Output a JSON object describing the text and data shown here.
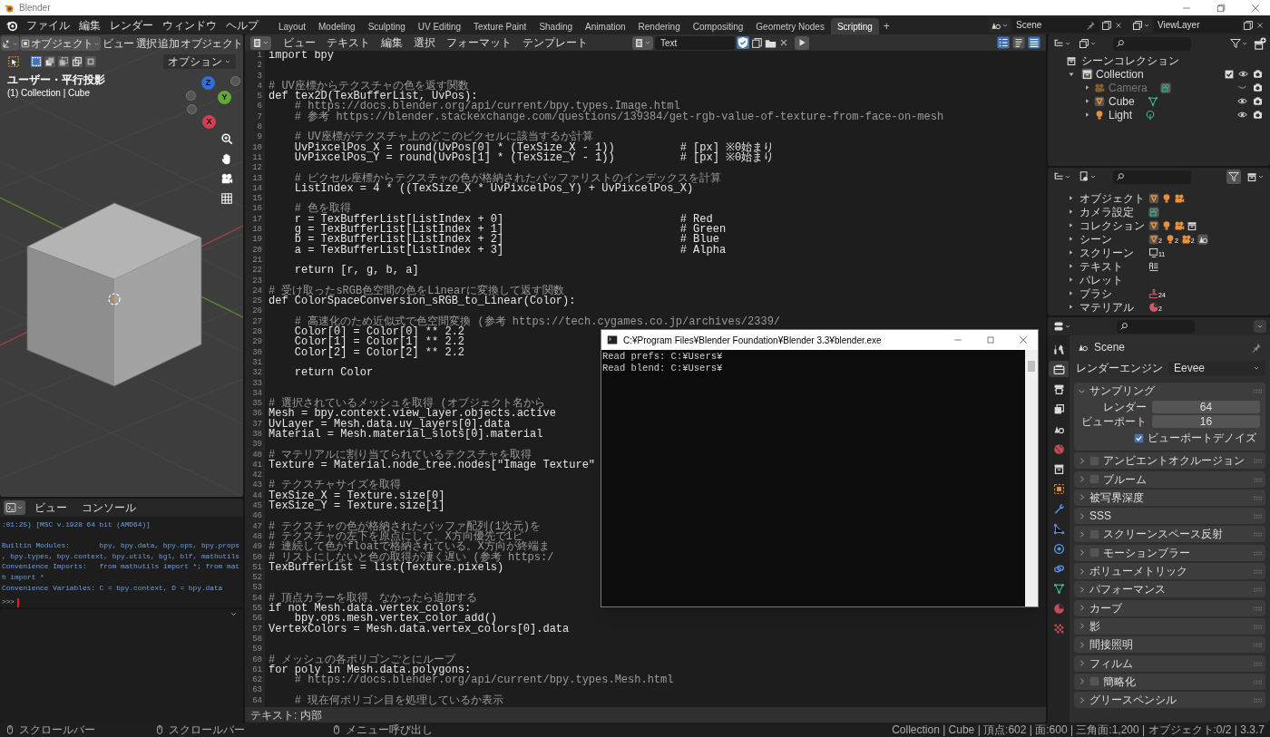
{
  "window": {
    "title": "Blender"
  },
  "menu_bar": {
    "menus": [
      "ファイル",
      "編集",
      "レンダー",
      "ウィンドウ",
      "ヘルプ"
    ],
    "workspaces": [
      {
        "label": "Layout",
        "selected": false
      },
      {
        "label": "Modeling",
        "selected": false
      },
      {
        "label": "Sculpting",
        "selected": false
      },
      {
        "label": "UV Editing",
        "selected": false
      },
      {
        "label": "Texture Paint",
        "selected": false
      },
      {
        "label": "Shading",
        "selected": false
      },
      {
        "label": "Animation",
        "selected": false
      },
      {
        "label": "Rendering",
        "selected": false
      },
      {
        "label": "Compositing",
        "selected": false
      },
      {
        "label": "Geometry Nodes",
        "selected": false
      },
      {
        "label": "Scripting",
        "selected": true
      }
    ],
    "add_workspace": "+",
    "scene": "Scene",
    "view_layer": "ViewLayer"
  },
  "viewport": {
    "mode": "オブジェクト",
    "menus": [
      "ビュー",
      "選択",
      "追加",
      "オブジェクト"
    ],
    "options": "オプション",
    "view_name": "ユーザー・平行投影",
    "context": "(1) Collection | Cube",
    "gizmo_axes": [
      {
        "label": "Z",
        "color": "#2f6fd6"
      },
      {
        "label": "Y",
        "color": "#62a83a"
      },
      {
        "label": "X",
        "color": "#d33f52"
      }
    ]
  },
  "console": {
    "menus": [
      "ビュー",
      "コンソール"
    ],
    "lines": [
      {
        "kind": "output",
        "text": ":01:25) [MSC v.1928 64 bit (AMD64)]"
      },
      {
        "kind": "blank"
      },
      {
        "kind": "output",
        "text": "Builtin Modules:       bpy, bpy.data, bpy.ops, bpy.props"
      },
      {
        "kind": "output",
        "text": ", bpy.types, bpy.context, bpy.utils, bgl, blf, mathutils"
      },
      {
        "kind": "output",
        "text": "Convenience Imports:   from mathutils import *; from mat"
      },
      {
        "kind": "output",
        "text": "h import *"
      },
      {
        "kind": "output",
        "text": "Convenience Variables: C = bpy.context, D = bpy.data"
      }
    ],
    "prompt": ">>>"
  },
  "text_editor": {
    "menus": [
      "ビュー",
      "テキスト",
      "編集",
      "選択",
      "フォーマット",
      "テンプレート"
    ],
    "text_name": "Text",
    "fake_user": true,
    "toggles": [
      {
        "kind": "line-numbers",
        "on": true
      },
      {
        "kind": "word-wrap",
        "on": false
      },
      {
        "kind": "syntax",
        "on": true
      }
    ],
    "lines": [
      {
        "number": "1",
        "kind": "code",
        "code": "import bpy"
      },
      {
        "number": "2",
        "kind": "blank"
      },
      {
        "number": "3",
        "kind": "blank"
      },
      {
        "number": "4",
        "kind": "comment",
        "code": "# UV座標からテクスチャの色を返す関数"
      },
      {
        "number": "5",
        "kind": "code",
        "code": "def tex2D(TexBufferList, UvPos):"
      },
      {
        "number": "6",
        "kind": "comment",
        "code": "    # https://docs.blender.org/api/current/bpy.types.Image.html"
      },
      {
        "number": "7",
        "kind": "comment",
        "code": "    # 参考 https://blender.stackexchange.com/questions/139384/get-rgb-value-of-texture-from-face-on-mesh"
      },
      {
        "number": "8",
        "kind": "blank"
      },
      {
        "number": "9",
        "kind": "comment",
        "code": "    # UV座標がテクスチャ上のどこのピクセルに該当するか計算"
      },
      {
        "number": "10",
        "kind": "code",
        "code": "    UvPixcelPos_X = round(UvPos[0] * (TexSize_X - 1))          # [px] ※0始まり"
      },
      {
        "number": "11",
        "kind": "code",
        "code": "    UvPixcelPos_Y = round(UvPos[1] * (TexSize_Y - 1))          # [px] ※0始まり"
      },
      {
        "number": "12",
        "kind": "blank"
      },
      {
        "number": "13",
        "kind": "comment",
        "code": "    # ピクセル座標からテクスチャの色が格納されたバッファリストのインデックスを計算"
      },
      {
        "number": "14",
        "kind": "code",
        "code": "    ListIndex = 4 * ((TexSize_X * UvPixcelPos_Y) + UvPixcelPos_X)"
      },
      {
        "number": "15",
        "kind": "blank"
      },
      {
        "number": "16",
        "kind": "comment",
        "code": "    # 色を取得"
      },
      {
        "number": "17",
        "kind": "code",
        "code": "    r = TexBufferList[ListIndex + 0]                           # Red"
      },
      {
        "number": "18",
        "kind": "code",
        "code": "    g = TexBufferList[ListIndex + 1]                           # Green"
      },
      {
        "number": "19",
        "kind": "code",
        "code": "    b = TexBufferList[ListIndex + 2]                           # Blue"
      },
      {
        "number": "20",
        "kind": "code",
        "code": "    a = TexBufferList[ListIndex + 3]                           # Alpha"
      },
      {
        "number": "21",
        "kind": "blank"
      },
      {
        "number": "22",
        "kind": "code",
        "code": "    return [r, g, b, a]"
      },
      {
        "number": "23",
        "kind": "blank"
      },
      {
        "number": "24",
        "kind": "comment",
        "code": "# 受け取ったsRGB色空間の色をLinearに変換して返す関数"
      },
      {
        "number": "25",
        "kind": "code",
        "code": "def ColorSpaceConversion_sRGB_to_Linear(Color):"
      },
      {
        "number": "26",
        "kind": "blank"
      },
      {
        "number": "27",
        "kind": "comment",
        "code": "    # 高速化のため近似式で色空間変換 (参考 https://tech.cygames.co.jp/archives/2339/"
      },
      {
        "number": "28",
        "kind": "code",
        "code": "    Color[0] = Color[0] ** 2.2"
      },
      {
        "number": "29",
        "kind": "code",
        "code": "    Color[1] = Color[1] ** 2.2"
      },
      {
        "number": "30",
        "kind": "code",
        "code": "    Color[2] = Color[2] ** 2.2"
      },
      {
        "number": "31",
        "kind": "blank"
      },
      {
        "number": "32",
        "kind": "code",
        "code": "    return Color"
      },
      {
        "number": "33",
        "kind": "blank"
      },
      {
        "number": "34",
        "kind": "blank"
      },
      {
        "number": "35",
        "kind": "comment",
        "code": "# 選択されているメッシュを取得 (オブジェクト名から"
      },
      {
        "number": "36",
        "kind": "code",
        "code": "Mesh = bpy.context.view_layer.objects.active"
      },
      {
        "number": "37",
        "kind": "code",
        "code": "UvLayer = Mesh.data.uv_layers[0].data"
      },
      {
        "number": "38",
        "kind": "code",
        "code": "Material = Mesh.material_slots[0].material"
      },
      {
        "number": "39",
        "kind": "blank"
      },
      {
        "number": "40",
        "kind": "comment",
        "code": "# マテリアルに割り当てられているテクスチャを取得"
      },
      {
        "number": "41",
        "kind": "code",
        "code": "Texture = Material.node_tree.nodes[\"Image Texture\""
      },
      {
        "number": "42",
        "kind": "blank"
      },
      {
        "number": "43",
        "kind": "comment",
        "code": "# テクスチャサイズを取得"
      },
      {
        "number": "44",
        "kind": "code",
        "code": "TexSize_X = Texture.size[0]"
      },
      {
        "number": "45",
        "kind": "code",
        "code": "TexSize_Y = Texture.size[1]"
      },
      {
        "number": "46",
        "kind": "blank"
      },
      {
        "number": "47",
        "kind": "comment",
        "code": "# テクスチャの色が格納されたバッファ配列(1次元)を"
      },
      {
        "number": "48",
        "kind": "comment",
        "code": "# テクスチャの左下を原点にして、X方向優先で1ピ"
      },
      {
        "number": "49",
        "kind": "comment",
        "code": "# 連続して色がfloatで格納されている。X方向が終端ま"
      },
      {
        "number": "50",
        "kind": "comment",
        "code": "# リストにしないと色の取得が凄く遅い (参考 https:/"
      },
      {
        "number": "51",
        "kind": "code",
        "code": "TexBufferList = list(Texture.pixels)"
      },
      {
        "number": "52",
        "kind": "blank"
      },
      {
        "number": "53",
        "kind": "blank"
      },
      {
        "number": "54",
        "kind": "comment",
        "code": "# 頂点カラーを取得、なかったら追加する"
      },
      {
        "number": "55",
        "kind": "code",
        "code": "if not Mesh.data.vertex_colors:"
      },
      {
        "number": "56",
        "kind": "code",
        "code": "    bpy.ops.mesh.vertex_color_add()"
      },
      {
        "number": "57",
        "kind": "code",
        "code": "VertexColors = Mesh.data.vertex_colors[0].data"
      },
      {
        "number": "58",
        "kind": "blank"
      },
      {
        "number": "59",
        "kind": "blank"
      },
      {
        "number": "60",
        "kind": "comment",
        "code": "# メッシュの各ポリゴンごとにループ"
      },
      {
        "number": "61",
        "kind": "code",
        "code": "for poly in Mesh.data.polygons:"
      },
      {
        "number": "62",
        "kind": "comment",
        "code": "    # https://docs.blender.org/api/current/bpy.types.Mesh.html"
      },
      {
        "number": "63",
        "kind": "blank"
      },
      {
        "number": "64",
        "kind": "comment",
        "code": "    # 現在何ポリゴン目を処理しているか表示"
      }
    ],
    "footer": "テキスト: 内部"
  },
  "console_window": {
    "title": "C:¥Program Files¥Blender Foundation¥Blender 3.3¥blender.exe",
    "lines": [
      "Read prefs: C:¥Users¥",
      "Read blend: C:¥Users¥"
    ]
  },
  "outliner": {
    "root": "シーンコレクション",
    "collection": {
      "label": "Collection",
      "expanded": true,
      "checked": true,
      "children": [
        {
          "label": "Camera",
          "kind": "camera",
          "visible": false
        },
        {
          "label": "Cube",
          "kind": "mesh",
          "visible": true
        },
        {
          "label": "Light",
          "kind": "light",
          "visible": true
        }
      ]
    }
  },
  "data_outliner": {
    "items": [
      {
        "label": "オブジェクト",
        "icons": [
          {
            "kind": "mesh"
          },
          {
            "kind": "light"
          },
          {
            "kind": "camera"
          }
        ]
      },
      {
        "label": "カメラ設定",
        "icons": [
          {
            "kind": "camera-data"
          }
        ]
      },
      {
        "label": "コレクション",
        "icons": [
          {
            "kind": "mesh"
          },
          {
            "kind": "light"
          },
          {
            "kind": "camera"
          },
          {
            "kind": "collection"
          }
        ]
      },
      {
        "label": "シーン",
        "icons": [
          {
            "kind": "mesh",
            "count": "2"
          },
          {
            "kind": "light",
            "count": "2"
          },
          {
            "kind": "camera",
            "count": "2"
          },
          {
            "kind": "scene"
          }
        ]
      },
      {
        "label": "スクリーン",
        "icons": [
          {
            "kind": "screen",
            "count": "11"
          }
        ]
      },
      {
        "label": "テキスト",
        "icons": [
          {
            "kind": "text"
          }
        ]
      },
      {
        "label": "パレット"
      },
      {
        "label": "ブラシ",
        "icons": [
          {
            "kind": "brush",
            "count": "24"
          }
        ]
      },
      {
        "label": "マテリアル",
        "icons": [
          {
            "kind": "material",
            "count": "2"
          }
        ]
      }
    ]
  },
  "properties": {
    "tabs": [
      {
        "kind": "tool",
        "selected": false
      },
      {
        "kind": "render",
        "selected": true
      },
      {
        "kind": "output",
        "selected": false
      },
      {
        "kind": "view-layer",
        "selected": false
      },
      {
        "kind": "scene",
        "selected": false
      },
      {
        "kind": "world",
        "selected": false
      },
      {
        "kind": "collection",
        "selected": false
      },
      {
        "kind": "object",
        "selected": false
      },
      {
        "kind": "modifier",
        "selected": false
      },
      {
        "kind": "particles",
        "selected": false
      },
      {
        "kind": "physics",
        "selected": false
      },
      {
        "kind": "constraints",
        "selected": false
      },
      {
        "kind": "data",
        "selected": false
      },
      {
        "kind": "material",
        "selected": false
      },
      {
        "kind": "texture",
        "selected": false
      }
    ],
    "context": "Scene",
    "render_engine": {
      "label": "レンダーエンジン",
      "value": "Eevee"
    },
    "sampling": {
      "title": "サンプリング",
      "expanded": true,
      "fields": [
        {
          "label": "レンダー",
          "value": "64"
        },
        {
          "label": "ビューポート",
          "value": "16"
        }
      ],
      "option": {
        "label": "ビューポートデノイズ",
        "checked": true
      }
    },
    "panels": [
      {
        "title": "アンビエントオクルージョン",
        "kind": "toggle",
        "checked": false
      },
      {
        "title": "ブルーム",
        "kind": "toggle",
        "checked": false
      },
      {
        "title": "被写界深度",
        "kind": "plain"
      },
      {
        "title": "SSS",
        "kind": "plain"
      },
      {
        "title": "スクリーンスペース反射",
        "kind": "toggle",
        "checked": false
      },
      {
        "title": "モーションブラー",
        "kind": "toggle",
        "checked": false
      },
      {
        "title": "ボリューメトリック",
        "kind": "plain"
      },
      {
        "title": "パフォーマンス",
        "kind": "plain"
      },
      {
        "title": "カーブ",
        "kind": "plain"
      },
      {
        "title": "影",
        "kind": "plain"
      },
      {
        "title": "間接照明",
        "kind": "plain"
      },
      {
        "title": "フィルム",
        "kind": "plain"
      },
      {
        "title": "簡略化",
        "kind": "toggle",
        "checked": false
      },
      {
        "title": "グリースペンシル",
        "kind": "plain"
      }
    ]
  },
  "status_bar": {
    "hints": [
      "スクロールバー",
      "スクロールバー",
      "メニュー呼び出し"
    ],
    "stats": "Collection | Cube | 頂点:602 | 面:600 | 三角面:1,200 | オブジェクト:0/2 | 3.3.7"
  }
}
